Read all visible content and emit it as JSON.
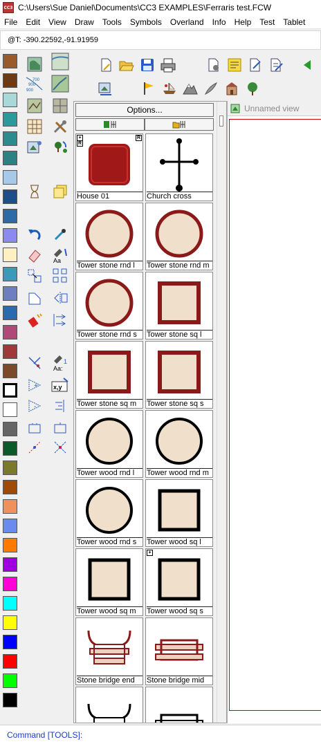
{
  "window": {
    "title": "C:\\Users\\Sue Daniel\\Documents\\CC3 EXAMPLES\\Ferraris test.FCW",
    "app_icon_text": "CC3"
  },
  "menu": [
    "File",
    "Edit",
    "View",
    "Draw",
    "Tools",
    "Symbols",
    "Overland",
    "Info",
    "Help",
    "Test",
    "Tablet"
  ],
  "coord_readout": "@T: -390.22592,-91.91959",
  "palette_colors": [
    "#9b5a2a",
    "#6d3a16",
    "#a8d8d8",
    "#2a9a9a",
    "#2a8c8c",
    "#2c8282",
    "#a8c8e8",
    "#1e4e8a",
    "#2c6aa8",
    "#8a8af0",
    "#fdf1c4",
    "#3a9ab8",
    "#6e7ec0",
    "#2a6ab0",
    "#b04878",
    "#a03a3a",
    "#7a4a2a",
    "#000000",
    "#ffffff",
    "#666666",
    "#0a5a2a",
    "#7a7a2a",
    "#a04a08",
    "#f0905a",
    "#6a8af0",
    "#ff7a00",
    "#a000e0",
    "#ff00d8",
    "#00ffff",
    "#ffff00",
    "#0000ff",
    "#ff0000",
    "#00ff00",
    "#000000"
  ],
  "symbols_panel": {
    "options_label": "Options...",
    "items": [
      {
        "label": "House 01",
        "shape": "house"
      },
      {
        "label": "Church cross",
        "shape": "cross"
      },
      {
        "label": "Tower stone rnd l",
        "shape": "circle-stone"
      },
      {
        "label": "Tower stone rnd m",
        "shape": "circle-stone"
      },
      {
        "label": "Tower stone rnd s",
        "shape": "circle-stone"
      },
      {
        "label": "Tower stone sq l",
        "shape": "square-stone"
      },
      {
        "label": "Tower stone sq m",
        "shape": "square-stone"
      },
      {
        "label": "Tower stone sq s",
        "shape": "square-stone"
      },
      {
        "label": "Tower wood rnd l",
        "shape": "circle-wood"
      },
      {
        "label": "Tower wood rnd m",
        "shape": "circle-wood"
      },
      {
        "label": "Tower wood rnd s",
        "shape": "circle-wood"
      },
      {
        "label": "Tower wood sq l",
        "shape": "square-wood"
      },
      {
        "label": "Tower wood sq m",
        "shape": "square-wood"
      },
      {
        "label": "Tower wood sq s",
        "shape": "square-wood"
      },
      {
        "label": "Stone bridge end",
        "shape": "bridge-end"
      },
      {
        "label": "Stone bridge mid",
        "shape": "bridge-mid"
      },
      {
        "label": "",
        "shape": "bridge-end-wood"
      },
      {
        "label": "",
        "shape": "bridge-mid-wood"
      }
    ]
  },
  "view": {
    "tab_label": "Unnamed view"
  },
  "command_line": "Command [TOOLS]:"
}
